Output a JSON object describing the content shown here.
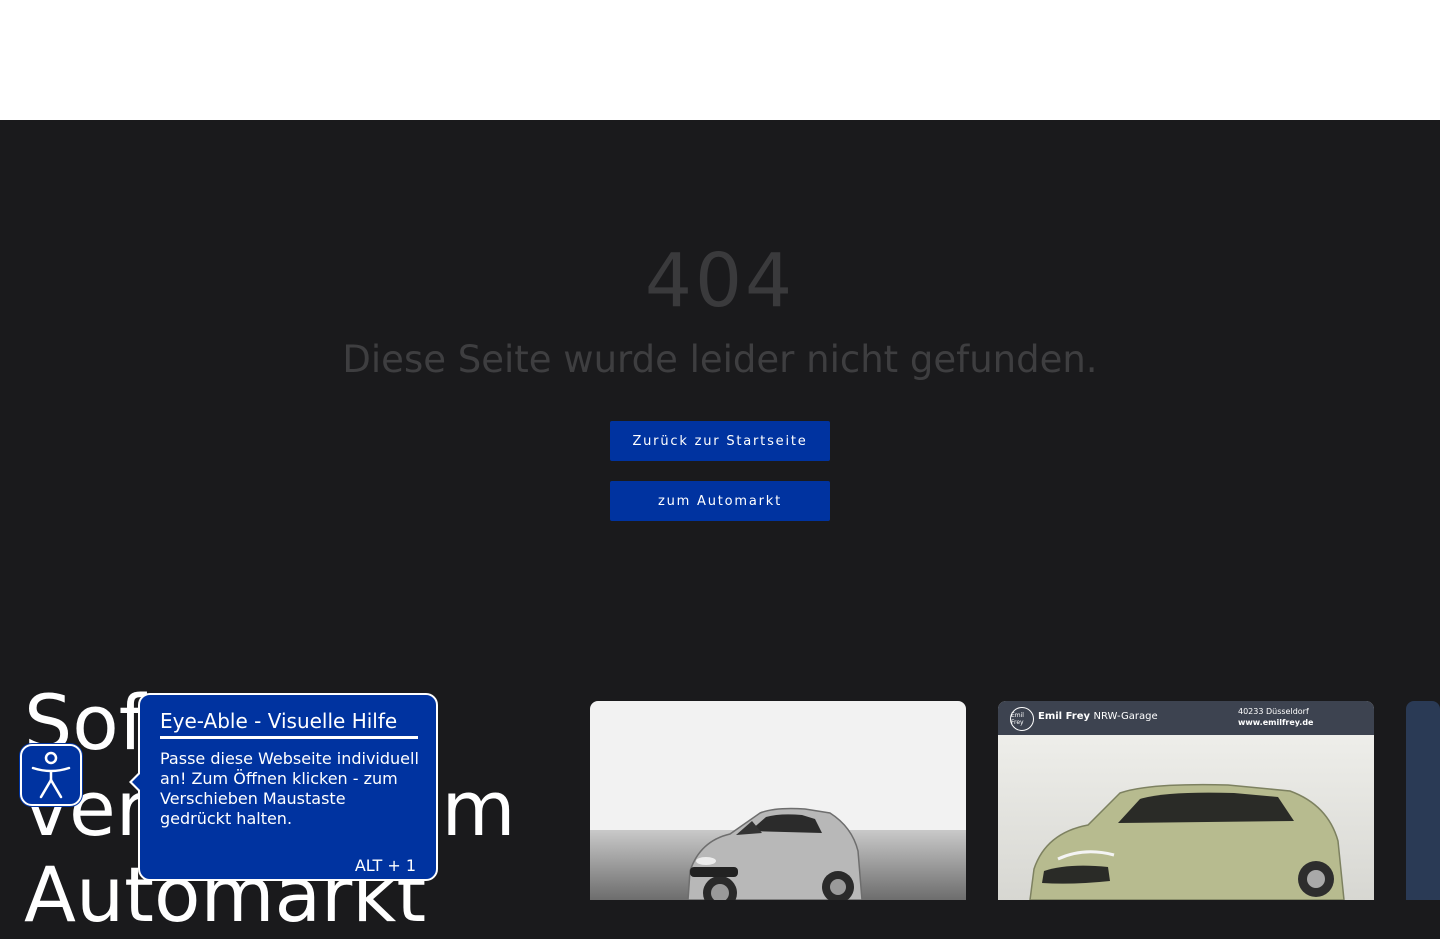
{
  "header": {},
  "error": {
    "code": "404",
    "message": "Diese Seite wurde leider nicht gefunden.",
    "home_button": "Zurück zur Startseite",
    "market_button": "zum Automarkt"
  },
  "section": {
    "heading_lines": [
      "Sofort",
      "verfügbar im",
      "Automarkt"
    ]
  },
  "cards": [
    {
      "image": "ford-fiesta-silver"
    },
    {
      "image": "suzuki-swift-green",
      "banner_brand": "Emil Frey",
      "banner_location": "NRW-Garage",
      "banner_city": "40233 Düsseldorf",
      "banner_url": "www.emilfrey.de",
      "seal_text": "Emil Frey"
    },
    {
      "image": "partial-card"
    }
  ],
  "accessibility": {
    "icon": "accessibility-person-icon",
    "tooltip_title": "Eye-Able - Visuelle Hilfe",
    "tooltip_body": "Passe diese Webseite individuell an! Zum Öffnen klicken - zum Verschieben Maustaste gedrückt halten.",
    "tooltip_shortcut": "ALT + 1"
  },
  "colors": {
    "background": "#1a1a1c",
    "accent": "#0033a0",
    "header": "#ffffff"
  }
}
